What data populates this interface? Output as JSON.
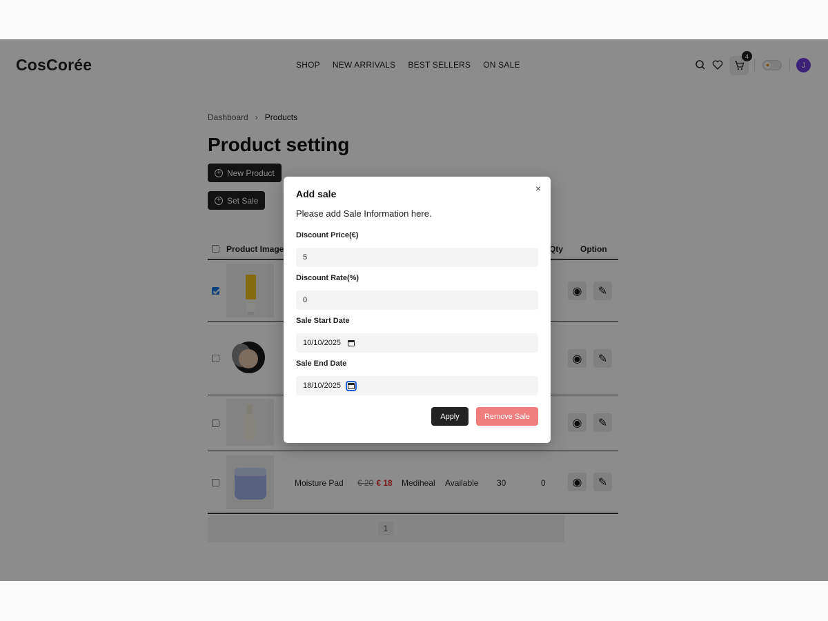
{
  "header": {
    "logo": "CosCorée",
    "nav": [
      "SHOP",
      "NEW ARRIVALS",
      "BEST SELLERS",
      "ON SALE"
    ],
    "cart_count": "4",
    "avatar_initial": "J"
  },
  "breadcrumb": {
    "parent": "Dashboard",
    "current": "Products"
  },
  "page_title": "Product setting",
  "actions": {
    "new_product": "New Product",
    "set_sale": "Set Sale"
  },
  "table": {
    "headers": {
      "image": "Product Image",
      "qty": "Qty",
      "option": "Option"
    },
    "rows": [
      {
        "checked": true
      },
      {
        "checked": false
      },
      {
        "checked": false
      },
      {
        "checked": false,
        "name": "Moisture Pad",
        "old_price": "€ 20",
        "new_price": "€ 18",
        "brand": "Mediheal",
        "status": "Available",
        "stock": "30",
        "qty": "0"
      }
    ]
  },
  "pagination": {
    "current": "1"
  },
  "modal": {
    "title": "Add sale",
    "description": "Please add Sale Information here.",
    "discount_price_label": "Discount Price(€)",
    "discount_price_value": "5",
    "discount_rate_label": "Discount Rate(%)",
    "discount_rate_value": "0",
    "start_date_label": "Sale Start Date",
    "start_date_value": "10/10/2025",
    "end_date_label": "Sale End Date",
    "end_date_value": "18/10/2025",
    "apply": "Apply",
    "remove": "Remove Sale",
    "close_icon": "×"
  },
  "colors": {
    "accent_dark": "#222222",
    "sale_red": "#e03030",
    "remove_btn": "#f07e7e",
    "checkbox_blue": "#1a73e8",
    "avatar": "#6d3fd8"
  }
}
